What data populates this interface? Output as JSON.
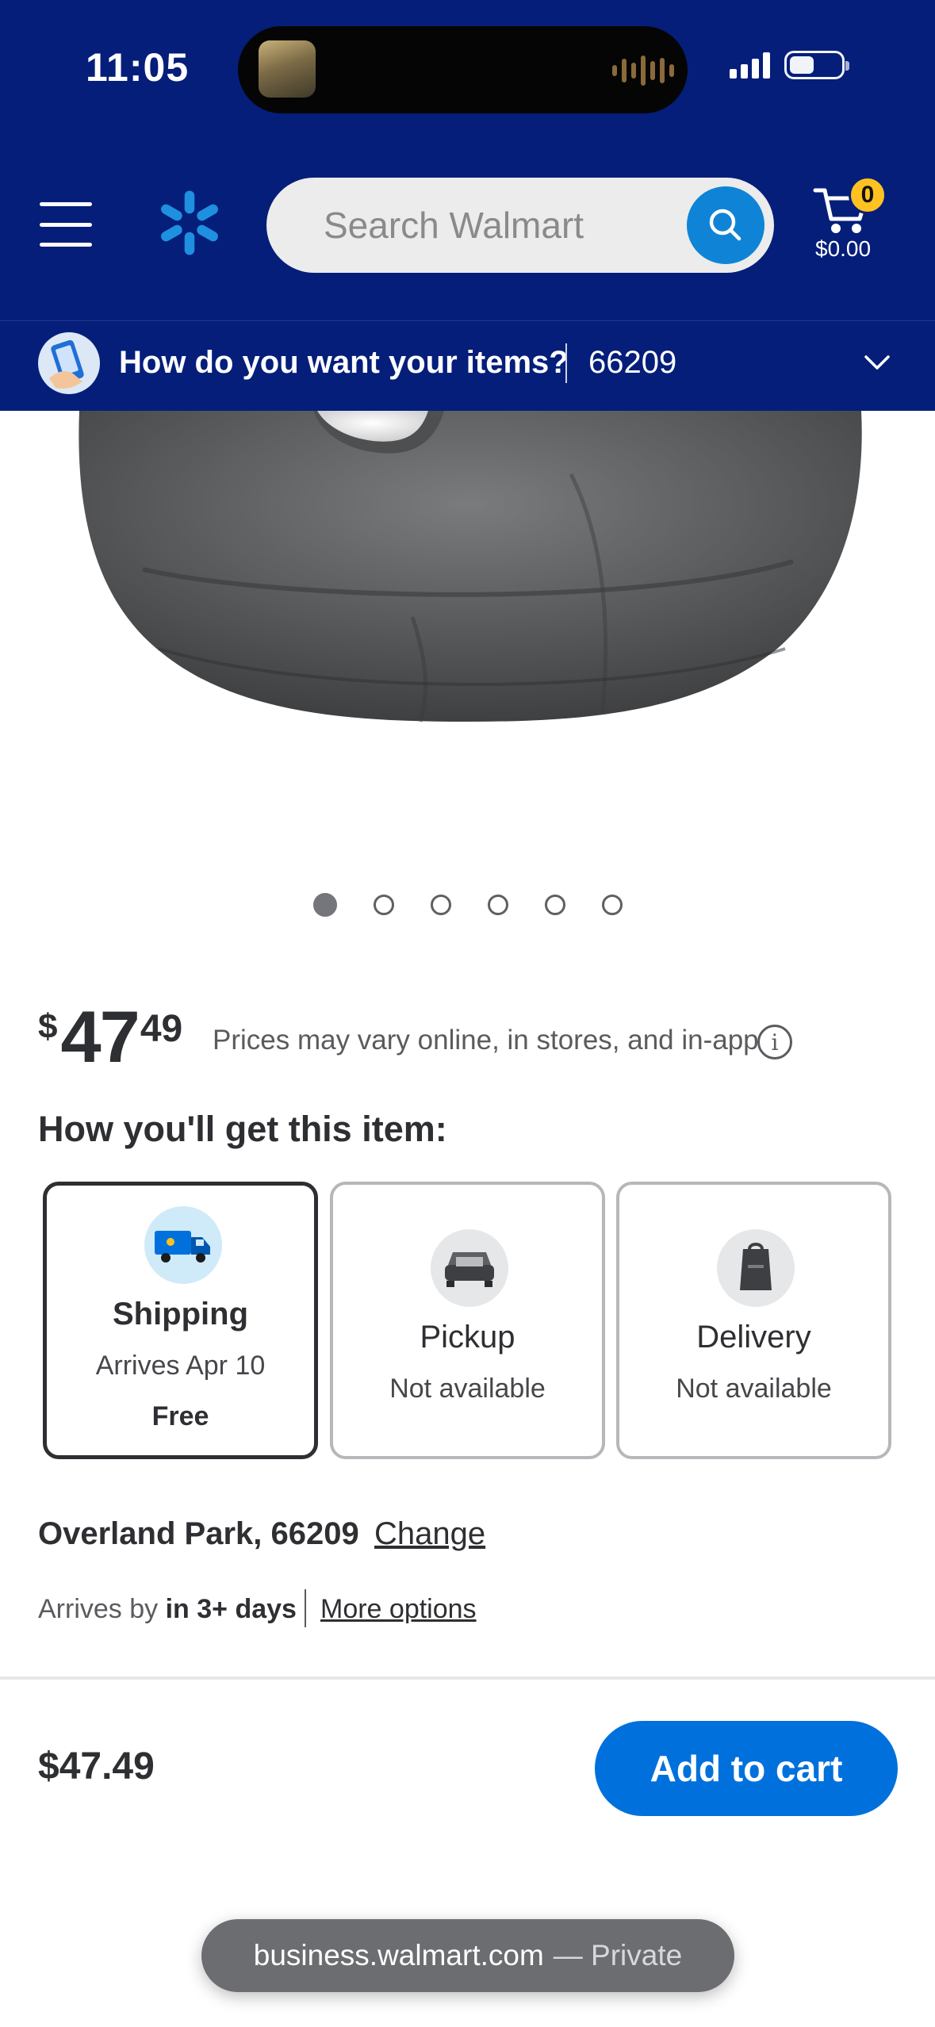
{
  "status_bar": {
    "time": "11:05"
  },
  "header": {
    "search_placeholder": "Search Walmart",
    "cart": {
      "count": "0",
      "total": "$0.00"
    },
    "brand_color": "#041e7a",
    "accent_color": "#ffc220"
  },
  "delivery_prompt": {
    "question": "How do you want your items?",
    "zip": "66209"
  },
  "carousel": {
    "total_images": 6,
    "active_index": 0
  },
  "price": {
    "currency": "$",
    "dollars": "47",
    "cents": "49",
    "note": "Prices may vary online, in stores, and in-app"
  },
  "fulfillment": {
    "title": "How you'll get this item:",
    "options": [
      {
        "label": "Shipping",
        "sub": "Arrives Apr 10",
        "extra": "Free",
        "selected": true,
        "icon": "truck-icon"
      },
      {
        "label": "Pickup",
        "sub": "Not available",
        "selected": false,
        "icon": "car-trunk-icon"
      },
      {
        "label": "Delivery",
        "sub": "Not available",
        "selected": false,
        "icon": "shopping-bag-icon"
      }
    ]
  },
  "location": {
    "name": "Overland Park, 66209",
    "change_label": "Change",
    "arrives_prefix": "Arrives by",
    "arrives_value": "in 3+ days",
    "more_options_label": "More options"
  },
  "bottom_bar": {
    "price": "$47.49",
    "add_to_cart_label": "Add to cart"
  },
  "browser": {
    "url": "business.walmart.com",
    "mode": "— Private"
  }
}
